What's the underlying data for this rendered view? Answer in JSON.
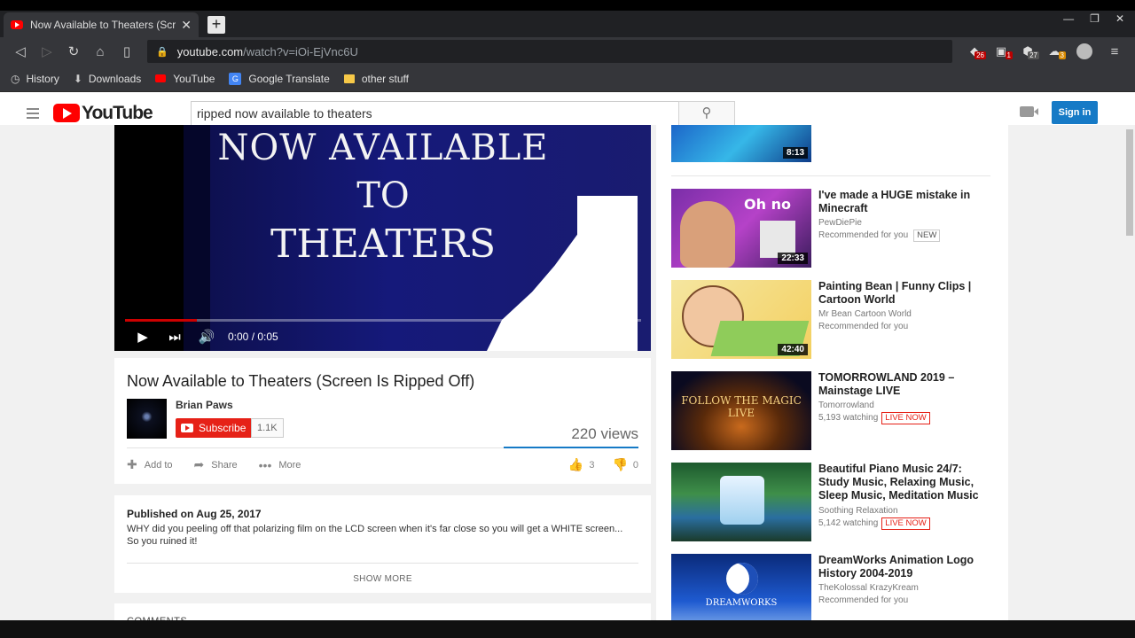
{
  "browser": {
    "tab_title": "Now Available to Theaters (Screen",
    "url_host": "youtube.com",
    "url_path": "/watch?v=iOi-EjVnc6U",
    "extensions": [
      {
        "name": "brave-shield-icon",
        "badge": "26"
      },
      {
        "name": "extension-icon",
        "badge": "1"
      },
      {
        "name": "ublock-icon",
        "badge": "27"
      },
      {
        "name": "cloud-icon",
        "badge": "3"
      }
    ]
  },
  "bookmarks": [
    {
      "label": "History",
      "icon": "history-icon"
    },
    {
      "label": "Downloads",
      "icon": "download-icon"
    },
    {
      "label": "YouTube",
      "icon": "youtube-icon"
    },
    {
      "label": "Google Translate",
      "icon": "translate-icon"
    },
    {
      "label": "other stuff",
      "icon": "folder-icon"
    }
  ],
  "masthead": {
    "logo": "YouTube",
    "search_value": "ripped now available to theaters",
    "sign_in": "Sign in"
  },
  "player": {
    "frame_text": [
      "NOW AVAILABLE",
      "TO",
      "THEATERS"
    ],
    "time": "0:00 / 0:05",
    "progress_fraction": 0.0
  },
  "video": {
    "title": "Now Available to Theaters (Screen Is Ripped Off)",
    "channel": "Brian Paws",
    "subscribe": "Subscribe",
    "sub_count": "1.1K",
    "views": "220 views",
    "add_to": "Add to",
    "share": "Share",
    "more": "More",
    "likes": "3",
    "dislikes": "0"
  },
  "description": {
    "published": "Published on Aug 25, 2017",
    "text": "WHY did you peeling off that polarizing film on the LCD screen when it's far close so you will get a WHITE screen... So you ruined it!",
    "show_more": "SHOW MORE",
    "comments_label": "COMMENTS"
  },
  "sidebar": {
    "top_duration": "8:13",
    "items": [
      {
        "title": "I've made a HUGE mistake in Minecraft",
        "channel": "PewDiePie",
        "line2": "Recommended for you",
        "tag": "NEW",
        "duration": "22:33",
        "thumb_text": "Oh no"
      },
      {
        "title": "Painting Bean | Funny Clips | Cartoon World",
        "channel": "Mr Bean Cartoon World",
        "line2": "Recommended for you",
        "tag": "",
        "duration": "42:40",
        "thumb_text": ""
      },
      {
        "title": "TOMORROWLAND 2019 – Mainstage LIVE",
        "channel": "Tomorrowland",
        "line2": "5,193 watching",
        "tag": "LIVE NOW",
        "duration": "",
        "thumb_text": "FOLLOW THE MAGIC LIVE"
      },
      {
        "title": "Beautiful Piano Music 24/7: Study Music, Relaxing Music, Sleep Music, Meditation Music",
        "channel": "Soothing Relaxation",
        "line2": "5,142 watching",
        "tag": "LIVE NOW",
        "duration": "",
        "thumb_text": ""
      },
      {
        "title": "DreamWorks Animation Logo History 2004-2019",
        "channel": "TheKolossal KrazyKream",
        "line2": "Recommended for you",
        "tag": "",
        "duration": "",
        "thumb_text": "DREAMWORKS"
      }
    ]
  },
  "colors": {
    "youtube_red": "#ff0000",
    "signin_blue": "#167ac6",
    "live_red": "#e62117"
  }
}
